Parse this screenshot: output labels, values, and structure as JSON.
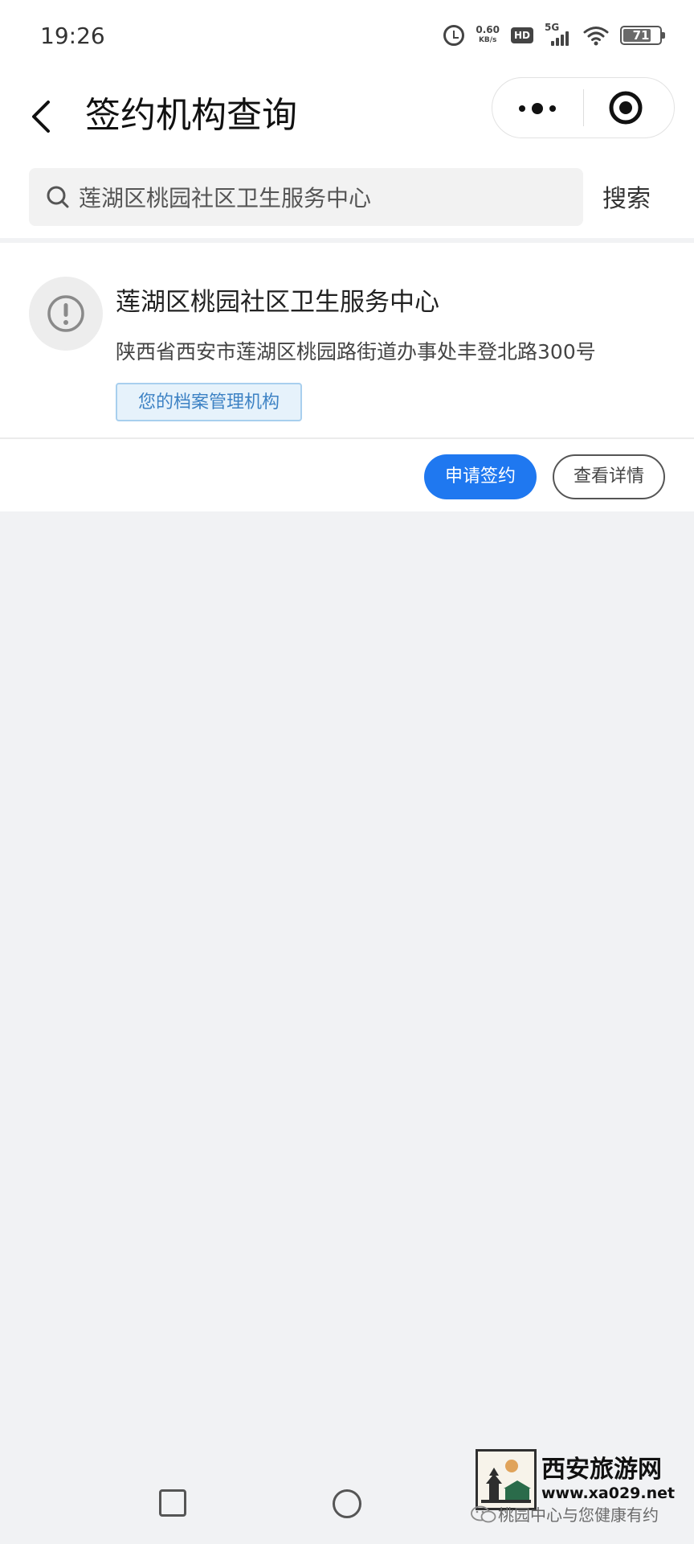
{
  "status_bar": {
    "time": "19:26",
    "net_speed_value": "0.60",
    "net_speed_unit": "KB/s",
    "hd_label": "HD",
    "network_label": "5G",
    "battery_level": "71",
    "icons": [
      "alarm-icon",
      "hd-icon",
      "signal-5g-icon",
      "wifi-icon",
      "battery-icon"
    ]
  },
  "nav": {
    "title": "签约机构查询",
    "back_icon": "chevron-left-icon",
    "more_icon": "more-dots-icon",
    "close_icon": "target-circle-icon"
  },
  "search": {
    "value": "莲湖区桃园社区卫生服务中心",
    "button_label": "搜索",
    "icon": "search-icon"
  },
  "results": [
    {
      "name": "莲湖区桃园社区卫生服务中心",
      "address": "陕西省西安市莲湖区桃园路街道办事处丰登北路300号",
      "tag": "您的档案管理机构",
      "icon": "exclamation-circle-icon"
    }
  ],
  "actions": {
    "apply_label": "申请签约",
    "detail_label": "查看详情"
  },
  "colors": {
    "primary": "#1f78f0",
    "tag_bg": "#e6f2fb",
    "tag_border": "#a8cfee",
    "tag_text": "#3d82c4",
    "page_bg": "#f1f2f4"
  },
  "watermark": {
    "title": "西安旅游网",
    "url": "www.xa029.net",
    "caption": "桃园中心与您健康有约"
  }
}
